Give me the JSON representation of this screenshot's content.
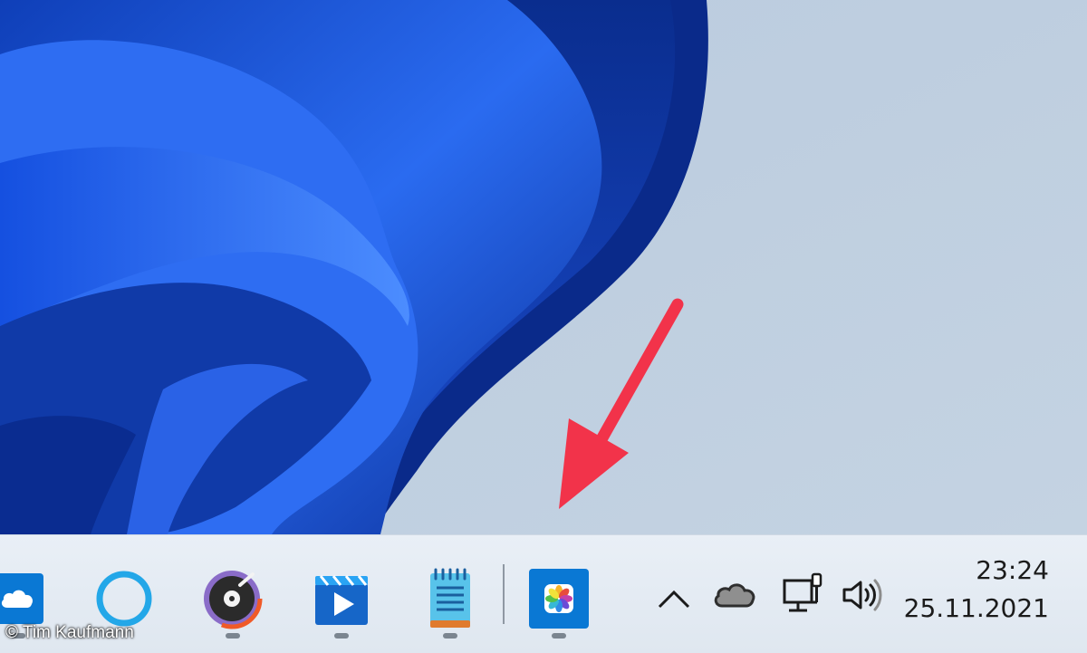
{
  "taskbar": {
    "apps": [
      {
        "name": "iCloud",
        "icon": "icloud-cloud-icon"
      },
      {
        "name": "Cortana",
        "icon": "cortana-ring-icon"
      },
      {
        "name": "Music player",
        "icon": "music-disc-icon"
      },
      {
        "name": "Movies & TV",
        "icon": "video-play-icon"
      },
      {
        "name": "Notepad",
        "icon": "notepad-icon"
      },
      {
        "name": "iCloud Photos",
        "icon": "photos-flower-icon"
      }
    ],
    "tray": {
      "overflow_icon": "chevron-up-icon",
      "onedrive_icon": "onedrive-cloud-icon",
      "network_icon": "network-computer-icon",
      "volume_icon": "speaker-icon"
    },
    "clock": {
      "time": "23:24",
      "date": "25.11.2021"
    }
  },
  "annotation": {
    "arrow_color": "#f2334a"
  },
  "credit": "© Tim Kaufmann",
  "colors": {
    "wallpaper_bg": "#b4c6d8",
    "bloom_blue": "#1a4fd6",
    "taskbar_bg": "#e9eff6",
    "accent_blue": "#0a78d4"
  }
}
